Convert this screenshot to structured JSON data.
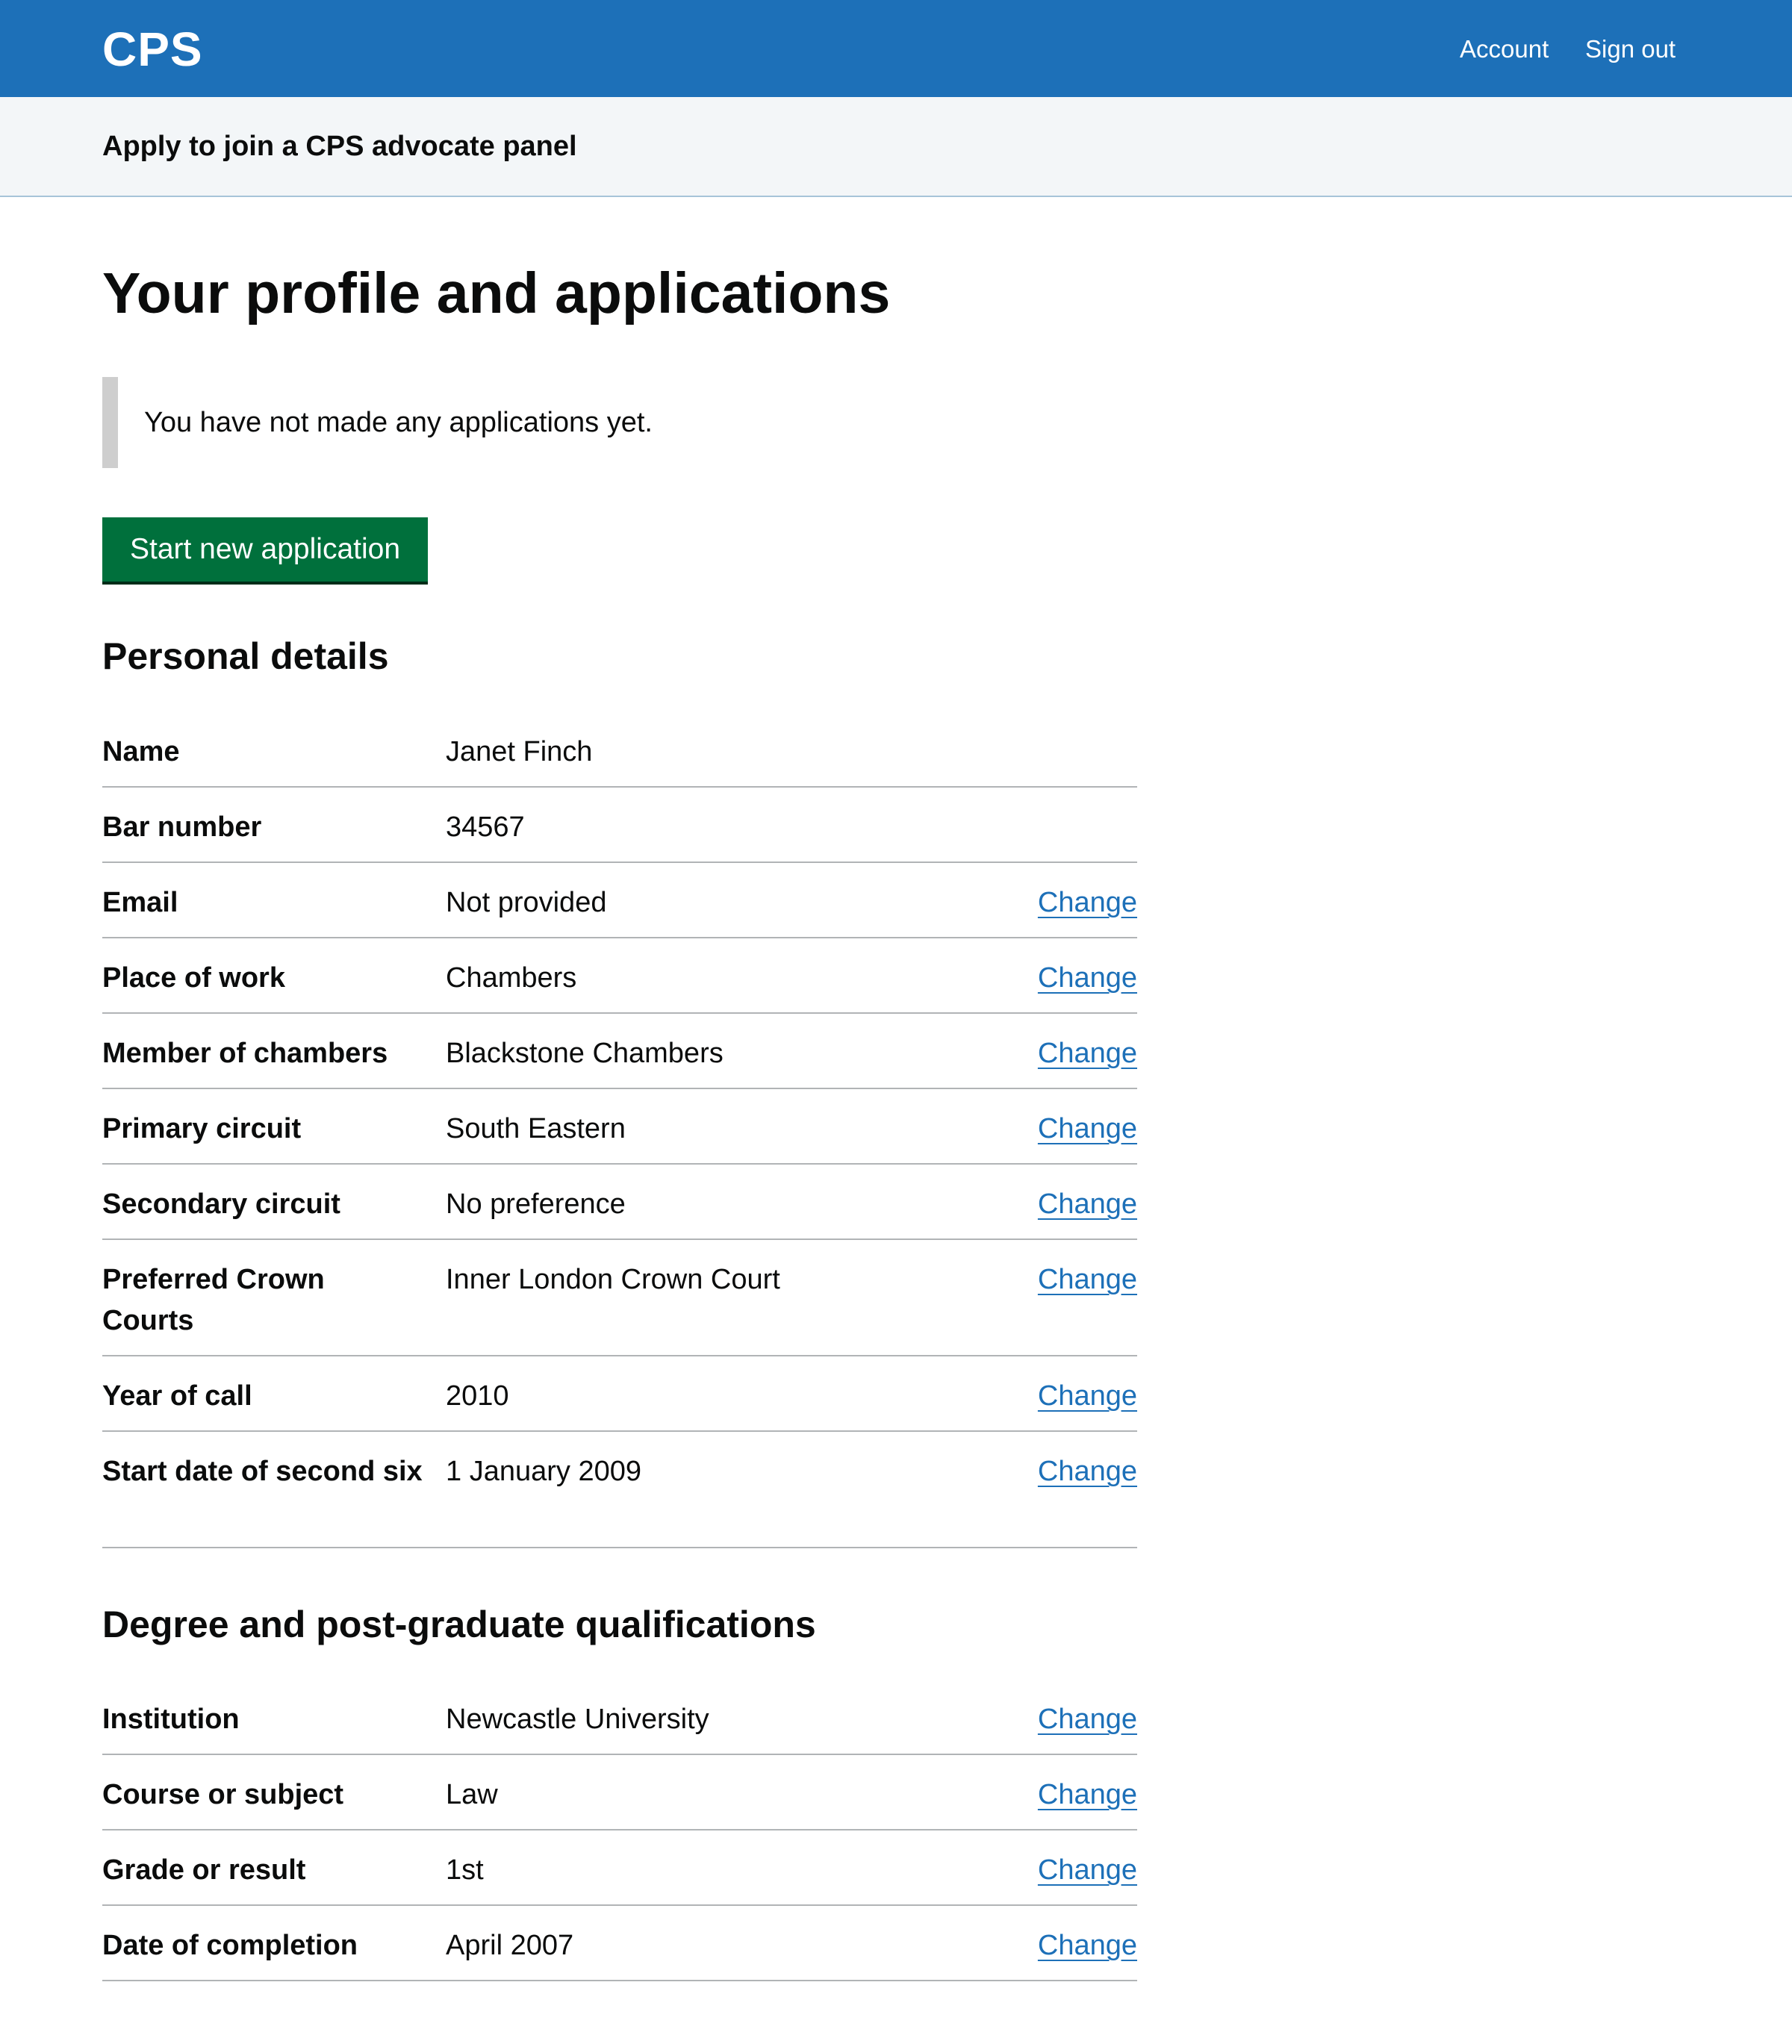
{
  "header": {
    "logo": "CPS",
    "nav": {
      "account": "Account",
      "sign_out": "Sign out"
    }
  },
  "service": {
    "name": "Apply to join a CPS advocate panel"
  },
  "page": {
    "title": "Your profile and applications",
    "inset_text": "You have not made any applications yet.",
    "start_button": "Start new application"
  },
  "personal": {
    "heading": "Personal details",
    "rows": [
      {
        "key": "Name",
        "value": "Janet Finch",
        "action": ""
      },
      {
        "key": "Bar number",
        "value": "34567",
        "action": ""
      },
      {
        "key": "Email",
        "value": "Not provided",
        "action": "Change"
      },
      {
        "key": "Place of work",
        "value": "Chambers",
        "action": "Change"
      },
      {
        "key": "Member of chambers",
        "value": "Blackstone Chambers",
        "action": "Change"
      },
      {
        "key": "Primary circuit",
        "value": "South Eastern",
        "action": "Change"
      },
      {
        "key": "Secondary circuit",
        "value": "No preference",
        "action": "Change"
      },
      {
        "key": "Preferred Crown Courts",
        "value": "Inner London Crown Court",
        "action": "Change"
      },
      {
        "key": "Year of call",
        "value": "2010",
        "action": "Change"
      },
      {
        "key": "Start date of second six",
        "value": "1 January 2009",
        "action": "Change"
      }
    ]
  },
  "degree": {
    "heading": "Degree and post-graduate qualifications",
    "rows": [
      {
        "key": "Institution",
        "value": "Newcastle University",
        "action": "Change"
      },
      {
        "key": "Course or subject",
        "value": "Law",
        "action": "Change"
      },
      {
        "key": "Grade or result",
        "value": "1st",
        "action": "Change"
      },
      {
        "key": "Date of completion",
        "value": "April 2007",
        "action": "Change"
      }
    ]
  }
}
